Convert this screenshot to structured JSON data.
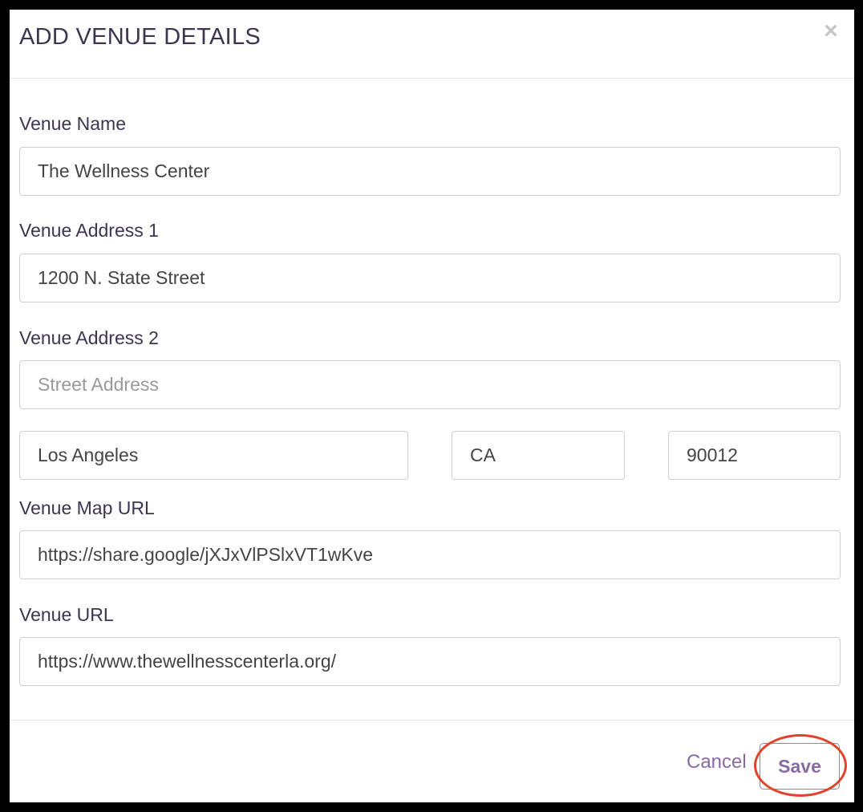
{
  "dialog": {
    "title": "ADD VENUE DETAILS",
    "close_symbol": "×"
  },
  "form": {
    "venue_name": {
      "label": "Venue Name",
      "value": "The Wellness Center",
      "placeholder": ""
    },
    "address1": {
      "label": "Venue Address 1",
      "value": "1200 N. State Street",
      "placeholder": ""
    },
    "address2": {
      "label": "Venue Address 2",
      "value": "",
      "placeholder": "Street Address"
    },
    "city": {
      "value": "Los Angeles"
    },
    "state": {
      "value": "CA"
    },
    "zip": {
      "value": "90012"
    },
    "map_url": {
      "label": "Venue Map URL",
      "value": "https://share.google/jXJxVlPSlxVT1wKve"
    },
    "venue_url": {
      "label": "Venue URL",
      "value": "https://www.thewellnesscenterla.org/"
    }
  },
  "footer": {
    "cancel_label": "Cancel",
    "save_label": "Save"
  },
  "colors": {
    "accent": "#8a6aa3",
    "label_text": "#3f3450",
    "annotation_ring": "#e2412a",
    "frame": "#000000"
  }
}
